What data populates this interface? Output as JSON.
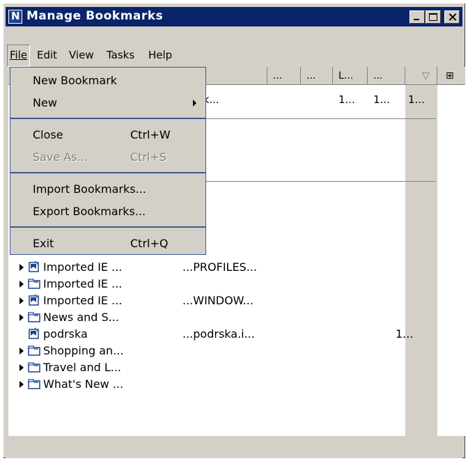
{
  "window": {
    "title": "Manage Bookmarks"
  },
  "menubar": [
    {
      "label": "File"
    },
    {
      "label": "Edit"
    },
    {
      "label": "View"
    },
    {
      "label": "Tasks"
    },
    {
      "label": "Help"
    }
  ],
  "file_menu": {
    "new_bookmark": "New Bookmark",
    "new": "New",
    "close": "Close",
    "close_shortcut": "Ctrl+W",
    "save_as": "Save As...",
    "save_as_shortcut": "Ctrl+S",
    "import": "Import Bookmarks...",
    "export": "Export Bookmarks...",
    "exit": "Exit",
    "exit_shortcut": "Ctrl+Q"
  },
  "columns": {
    "col3": "...",
    "col4": "...",
    "col5": "L...",
    "col6": "...",
    "sort": "▽",
    "picker": "⊞"
  },
  "top_row": {
    "url": "w.isk...",
    "c5": "1...",
    "c6": "1...",
    "c7": "1..."
  },
  "rows": [
    {
      "label": "Imported IE ...",
      "url": "...PROFILES...",
      "visit": "",
      "expandable": true,
      "icon": "bookmark-icon"
    },
    {
      "label": "Imported IE ...",
      "url": "",
      "visit": "",
      "expandable": true,
      "icon": "folder-icon"
    },
    {
      "label": "Imported IE ...",
      "url": "...WINDOW...",
      "visit": "",
      "expandable": true,
      "icon": "bookmark-icon"
    },
    {
      "label": "News and S...",
      "url": "",
      "visit": "",
      "expandable": true,
      "icon": "folder-icon"
    },
    {
      "label": "podrska",
      "url": "...podrska.i...",
      "visit": "1...",
      "expandable": false,
      "icon": "bookmark-icon"
    },
    {
      "label": "Shopping an...",
      "url": "",
      "visit": "",
      "expandable": true,
      "icon": "folder-icon"
    },
    {
      "label": "Travel and L...",
      "url": "",
      "visit": "",
      "expandable": true,
      "icon": "folder-icon"
    },
    {
      "label": "What's New ...",
      "url": "",
      "visit": "",
      "expandable": true,
      "icon": "folder-icon"
    }
  ],
  "colors": {
    "titlebar": "#0a246a",
    "face": "#d4d0c8",
    "menu_border": "#3a5a8c"
  }
}
